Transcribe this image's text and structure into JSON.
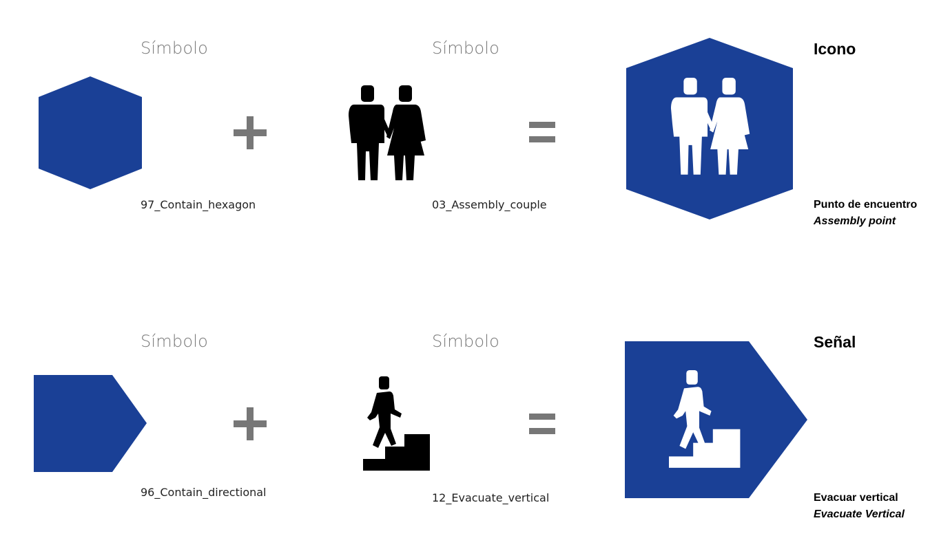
{
  "colors": {
    "brand_blue": "#1a4096",
    "operator_gray": "#777777",
    "pictogram": "#000000"
  },
  "rows": [
    {
      "shape_label": "Símbolo",
      "shape_code": "97_Contain_hexagon",
      "pictogram_label": "Símbolo",
      "pictogram_code": "03_Assembly_couple",
      "plus": "+",
      "equals": "=",
      "result_title": "Icono",
      "result_name_es": "Punto de encuentro",
      "result_name_en": "Assembly point",
      "icons": {
        "shape": "hexagon-icon",
        "pictogram": "couple-icon"
      }
    },
    {
      "shape_label": "Símbolo",
      "shape_code": "96_Contain_directional",
      "pictogram_label": "Símbolo",
      "pictogram_code": "12_Evacuate_vertical",
      "plus": "+",
      "equals": "=",
      "result_title": "Señal",
      "result_name_es": "Evacuar vertical",
      "result_name_en": "Evacuate Vertical",
      "icons": {
        "shape": "directional-arrow-shape-icon",
        "pictogram": "person-climbing-stairs-icon"
      }
    }
  ]
}
